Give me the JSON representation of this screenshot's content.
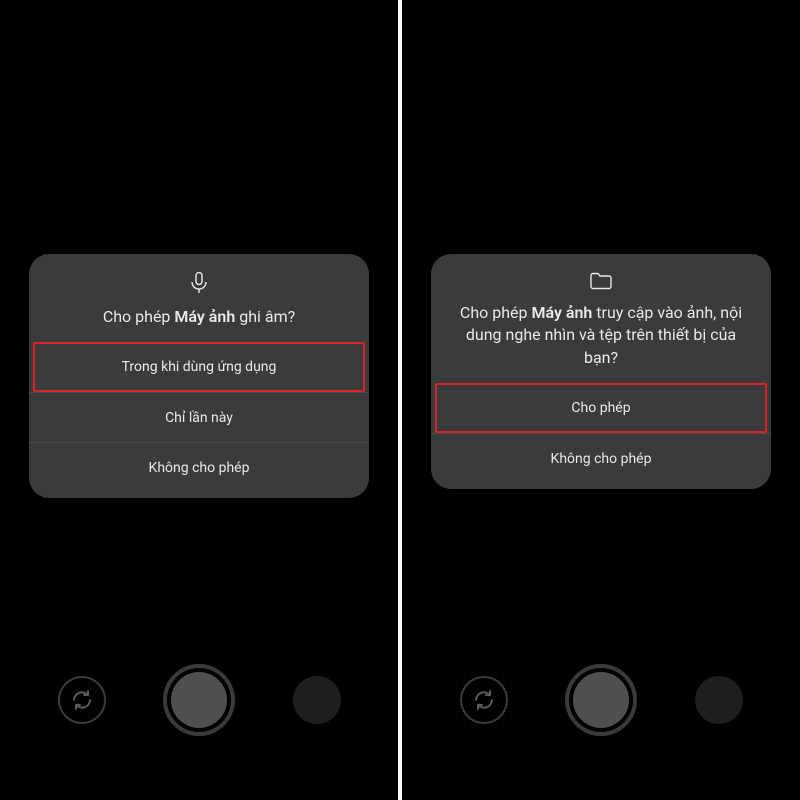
{
  "left": {
    "title_pre": "Cho phép ",
    "title_bold": "Máy ảnh",
    "title_post": " ghi âm?",
    "btn_while_using": "Trong khi dùng ứng dụng",
    "btn_only_this_time": "Chỉ lần này",
    "btn_deny": "Không cho phép"
  },
  "right": {
    "title_pre": "Cho phép ",
    "title_bold": "Máy ảnh",
    "title_post": " truy cập vào ảnh, nội dung nghe nhìn và tệp trên thiết bị của bạn?",
    "btn_allow": "Cho phép",
    "btn_deny": "Không cho phép"
  }
}
